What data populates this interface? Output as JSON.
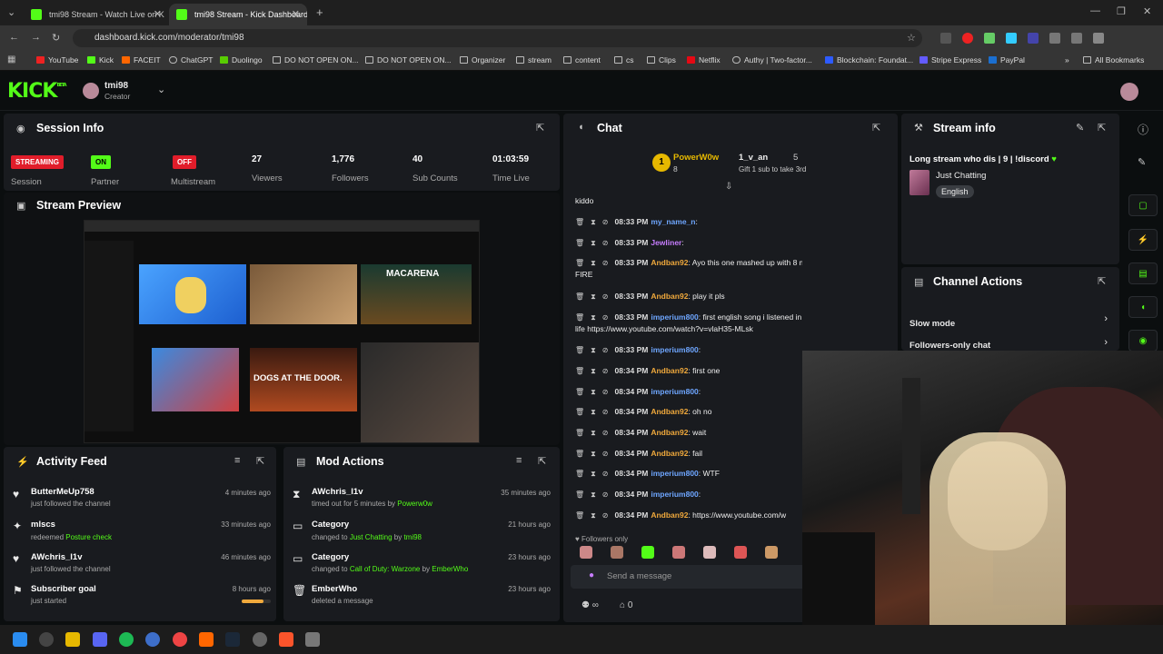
{
  "browser": {
    "tabs": [
      {
        "title": "tmi98 Stream - Watch Live on K"
      },
      {
        "title": "tmi98 Stream - Kick Dashboard"
      }
    ],
    "url": "dashboard.kick.com/moderator/tmi98",
    "bookmarks": [
      "YouTube",
      "Kick",
      "FACEIT",
      "ChatGPT",
      "Duolingo",
      "DO NOT OPEN ON...",
      "DO NOT OPEN ON...",
      "Organizer",
      "stream",
      "content",
      "cs",
      "Clips",
      "Netflix",
      "Authy | Two-factor...",
      "Blockchain: Foundat...",
      "Stripe Express",
      "PayPal",
      "All Bookmarks"
    ]
  },
  "header": {
    "logo": "KICK",
    "beta": "BETA",
    "username": "tmi98",
    "role": "Creator"
  },
  "session": {
    "title": "Session Info",
    "statuses": [
      {
        "badge": "STREAMING",
        "label": "Session",
        "color": "#e11d2a"
      },
      {
        "badge": "ON",
        "label": "Partner",
        "color": "#53fc18"
      },
      {
        "badge": "OFF",
        "label": "Multistream",
        "color": "#e11d2a"
      }
    ],
    "stats": [
      {
        "value": "27",
        "label": "Viewers"
      },
      {
        "value": "1,776",
        "label": "Followers"
      },
      {
        "value": "40",
        "label": "Sub Counts"
      },
      {
        "value": "01:03:59",
        "label": "Time Live"
      }
    ]
  },
  "preview": {
    "title": "Stream Preview",
    "tiles": [
      "MACARENA",
      "DOGS AT THE DOOR."
    ]
  },
  "activity": {
    "title": "Activity Feed",
    "items": [
      {
        "name": "ButterMeUp758",
        "sub": "just followed the channel",
        "extra": "",
        "time": "4 minutes ago",
        "icon": "heart-icon"
      },
      {
        "name": "mlscs",
        "sub": "redeemed",
        "extra": "Posture check",
        "time": "33 minutes ago",
        "icon": "reward-icon"
      },
      {
        "name": "AWchris_l1v",
        "sub": "just followed the channel",
        "extra": "",
        "time": "46 minutes ago",
        "icon": "heart-icon"
      },
      {
        "name": "Subscriber goal",
        "sub": "just started",
        "extra": "",
        "time": "8 hours ago",
        "icon": "flag-icon",
        "progress": 0.75
      }
    ]
  },
  "mod": {
    "title": "Mod Actions",
    "items": [
      {
        "name": "AWchris_l1v",
        "sub": "timed out for 5 minutes by",
        "by": "Powerw0w",
        "time": "35 minutes ago",
        "icon": "hourglass-icon"
      },
      {
        "name": "Category",
        "sub": "changed to",
        "cat": "Just Chatting",
        "by": "tmi98",
        "time": "21 hours ago",
        "icon": "category-icon"
      },
      {
        "name": "Category",
        "sub": "changed to",
        "cat": "Call of Duty: Warzone",
        "by": "EmberWho",
        "time": "23 hours ago",
        "icon": "category-icon"
      },
      {
        "name": "EmberWho",
        "sub": "deleted a message",
        "time": "23 hours ago",
        "icon": "trash-icon"
      }
    ]
  },
  "chat": {
    "title": "Chat",
    "leaders": [
      {
        "name": "PowerW0w",
        "count": "8"
      },
      {
        "name": "1_v_an",
        "count": "5",
        "note": "Gift 1 sub to take 3rd"
      }
    ],
    "kiddo": "kiddo",
    "messages": [
      {
        "time": "08:33 PM",
        "user": "my_name_n",
        "cls": "ui",
        "text": ""
      },
      {
        "time": "08:33 PM",
        "user": "Jewliner",
        "cls": "uj",
        "text": ""
      },
      {
        "time": "08:33 PM",
        "user": "Andban92",
        "cls": "ua",
        "text": "Ayo this one mashed up with 8 miles is actually",
        "cont": "FIRE"
      },
      {
        "time": "08:33 PM",
        "user": "Andban92",
        "cls": "ua",
        "text": "play it pls"
      },
      {
        "time": "08:33 PM",
        "user": "imperium800",
        "cls": "ui",
        "text": "first english song i listened in my",
        "cont": "life https://www.youtube.com/watch?v=vlaH35-MLsk"
      },
      {
        "time": "08:33 PM",
        "user": "imperium800",
        "cls": "ui",
        "text": ""
      },
      {
        "time": "08:34 PM",
        "user": "Andban92",
        "cls": "ua",
        "text": "first one"
      },
      {
        "time": "08:34 PM",
        "user": "imperium800",
        "cls": "ui",
        "text": ""
      },
      {
        "time": "08:34 PM",
        "user": "Andban92",
        "cls": "ua",
        "text": "oh no"
      },
      {
        "time": "08:34 PM",
        "user": "Andban92",
        "cls": "ua",
        "text": "wait"
      },
      {
        "time": "08:34 PM",
        "user": "Andban92",
        "cls": "ua",
        "text": "fail"
      },
      {
        "time": "08:34 PM",
        "user": "imperium800",
        "cls": "ui",
        "text": "WTF"
      },
      {
        "time": "08:34 PM",
        "user": "imperium800",
        "cls": "ui",
        "text": ""
      },
      {
        "time": "08:34 PM",
        "user": "Andban92",
        "cls": "ua",
        "text": "https://www.youtube.com/w"
      }
    ],
    "followers_only": "Followers only",
    "placeholder": "Send a message",
    "counter_a": "∞",
    "counter_b": "0"
  },
  "stream_info": {
    "title": "Stream info",
    "stream_title": "Long stream who dis | 9 | !discord",
    "category": "Just Chatting",
    "language": "English"
  },
  "channel_actions": {
    "title": "Channel Actions",
    "items": [
      {
        "label": "Slow mode"
      },
      {
        "label": "Followers-only chat",
        "sub": "Instant"
      }
    ]
  }
}
